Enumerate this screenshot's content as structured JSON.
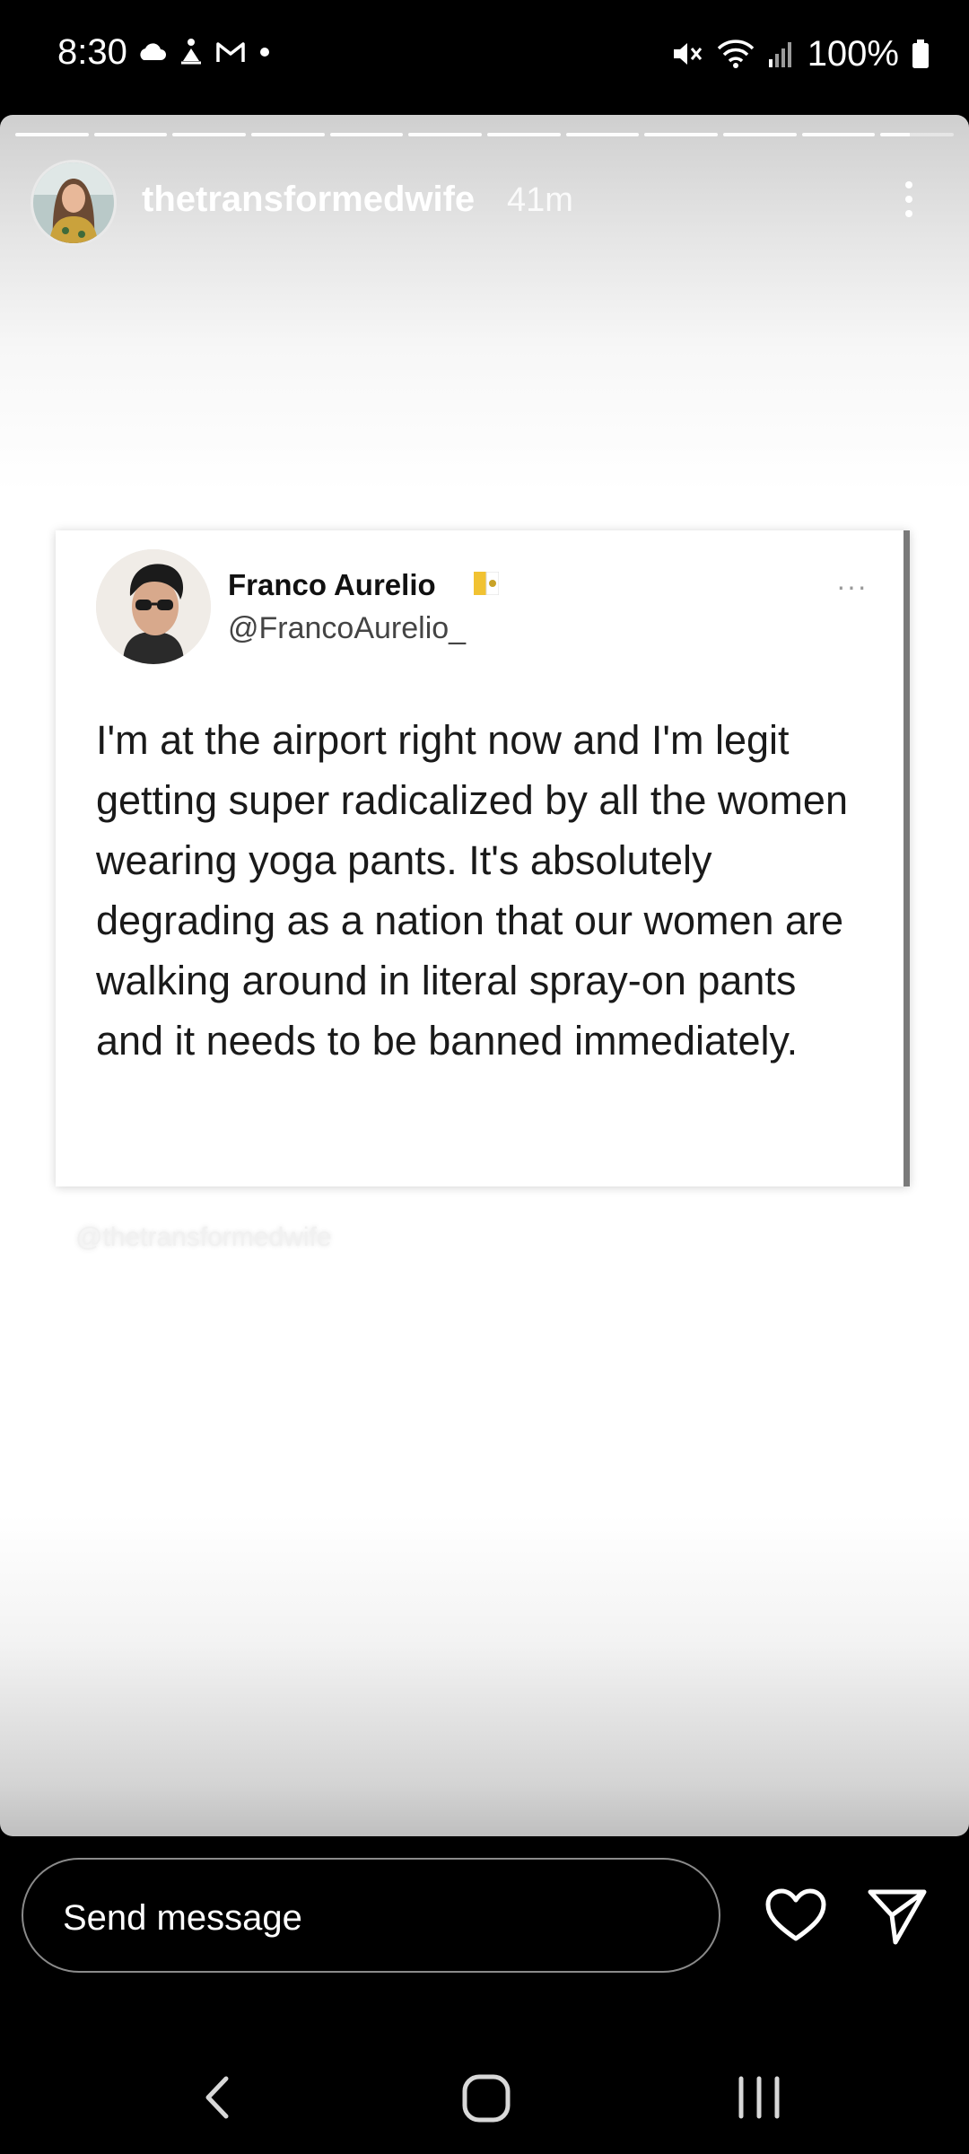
{
  "status_bar": {
    "time": "8:30",
    "battery": "100%"
  },
  "story": {
    "username": "thetransformedwife",
    "time_ago": "41m",
    "watermark": "@thetransformedwife"
  },
  "tweet": {
    "name": "Franco Aurelio",
    "handle": "@FrancoAurelio_",
    "more": "···",
    "text": "I'm at the airport right now and I'm legit getting super radicalized by all the women wearing yoga pants. It's absolutely degrading as a nation that our women are walking around in literal spray-on pants and it needs to be banned immediately."
  },
  "composer": {
    "placeholder": "Send message"
  },
  "icons": {
    "status_left": [
      "cloud-icon",
      "meditation-icon",
      "gmail-icon",
      "dot-icon"
    ],
    "status_right": [
      "mute-icon",
      "wifi-icon",
      "signal-icon",
      "battery-icon"
    ],
    "actions": [
      "heart-icon",
      "send-icon"
    ],
    "navigation": [
      "back-icon",
      "home-icon",
      "recents-icon"
    ]
  },
  "colors": {
    "background": "#000000",
    "story_text": "#ffffff",
    "tweet_text": "#1a1a1a"
  }
}
